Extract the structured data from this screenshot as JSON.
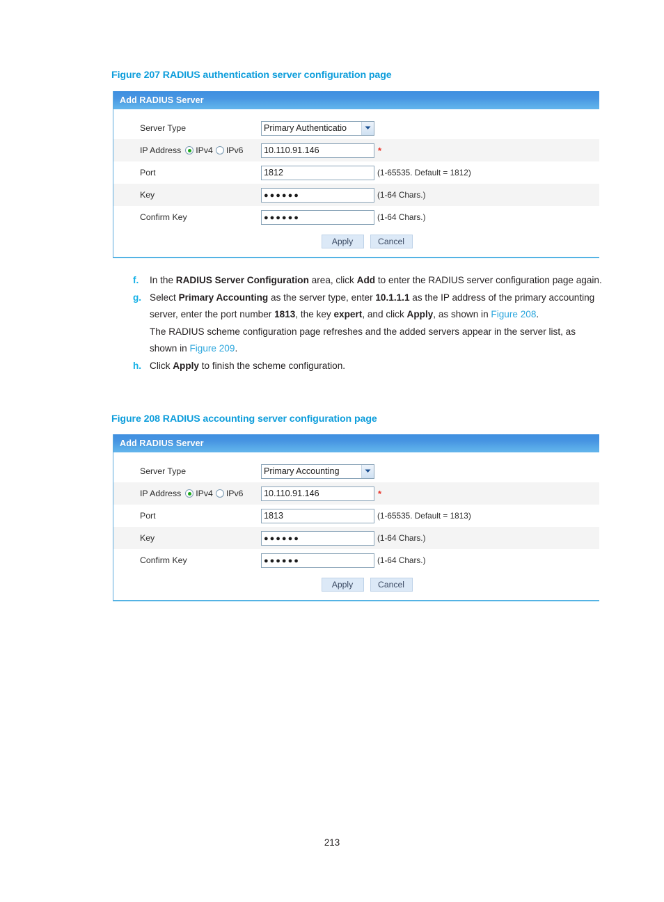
{
  "document": {
    "page_number": "213"
  },
  "figures": [
    {
      "caption": "Figure 207 RADIUS authentication server configuration page",
      "panel": {
        "title": "Add RADIUS Server",
        "rows": [
          {
            "label": "Server Type",
            "control": "select",
            "value": "Primary Authenticatio",
            "hint": ""
          },
          {
            "label": "IP Address",
            "control": "text",
            "value": "10.110.91.146",
            "hint": "",
            "required_mark": "*",
            "radios": [
              {
                "label": "IPv4",
                "checked": true
              },
              {
                "label": "IPv6",
                "checked": false
              }
            ]
          },
          {
            "label": "Port",
            "control": "text",
            "value": "1812",
            "hint": "(1-65535. Default = 1812)"
          },
          {
            "label": "Key",
            "control": "password",
            "value": "●●●●●●",
            "hint": "(1-64 Chars.)"
          },
          {
            "label": "Confirm Key",
            "control": "password",
            "value": "●●●●●●",
            "hint": "(1-64 Chars.)"
          }
        ],
        "buttons": {
          "apply": "Apply",
          "cancel": "Cancel"
        }
      }
    },
    {
      "caption": "Figure 208 RADIUS accounting server configuration page",
      "panel": {
        "title": "Add RADIUS Server",
        "rows": [
          {
            "label": "Server Type",
            "control": "select",
            "value": "Primary Accounting",
            "hint": ""
          },
          {
            "label": "IP Address",
            "control": "text",
            "value": "10.110.91.146",
            "hint": "",
            "required_mark": "*",
            "radios": [
              {
                "label": "IPv4",
                "checked": true
              },
              {
                "label": "IPv6",
                "checked": false
              }
            ]
          },
          {
            "label": "Port",
            "control": "text",
            "value": "1813",
            "hint": "(1-65535. Default = 1813)"
          },
          {
            "label": "Key",
            "control": "password",
            "value": "●●●●●●",
            "hint": "(1-64 Chars.)"
          },
          {
            "label": "Confirm Key",
            "control": "password",
            "value": "●●●●●●",
            "hint": "(1-64 Chars.)"
          }
        ],
        "buttons": {
          "apply": "Apply",
          "cancel": "Cancel"
        }
      }
    }
  ],
  "steps": {
    "f": {
      "marker": "f.",
      "text_1": "In the ",
      "bold_1": "RADIUS Server Configuration",
      "text_2": " area, click ",
      "bold_2": "Add",
      "text_3": " to enter the RADIUS server configuration page again."
    },
    "g": {
      "marker": "g.",
      "text_1": "Select ",
      "bold_1": "Primary Accounting",
      "text_2": " as the server type, enter ",
      "bold_2": "10.1.1.1",
      "text_3": " as the IP address of the primary accounting server, enter the port number ",
      "bold_3": "1813",
      "text_4": ", the key ",
      "bold_4": "expert",
      "text_5": ", and click ",
      "bold_5": "Apply",
      "text_6": ", as shown in ",
      "xref_1": "Figure 208",
      "text_7": ".",
      "sub_text_1": "The RADIUS scheme configuration page refreshes and the added servers appear in the server list, as shown in ",
      "sub_xref_1": "Figure 209",
      "sub_text_2": "."
    },
    "h": {
      "marker": "h.",
      "text_1": "Click ",
      "bold_1": "Apply",
      "text_2": " to finish the scheme configuration."
    }
  },
  "colors": {
    "caption": "#0d9ddb",
    "panel_header_top": "#3f8fe0",
    "panel_header_bottom": "#63b5ec",
    "marker": "#14b0e6",
    "xref": "#2ba6dd",
    "required": "#e8352b",
    "radio_dot": "#1aa81a",
    "row_alt": "#f4f4f4"
  }
}
